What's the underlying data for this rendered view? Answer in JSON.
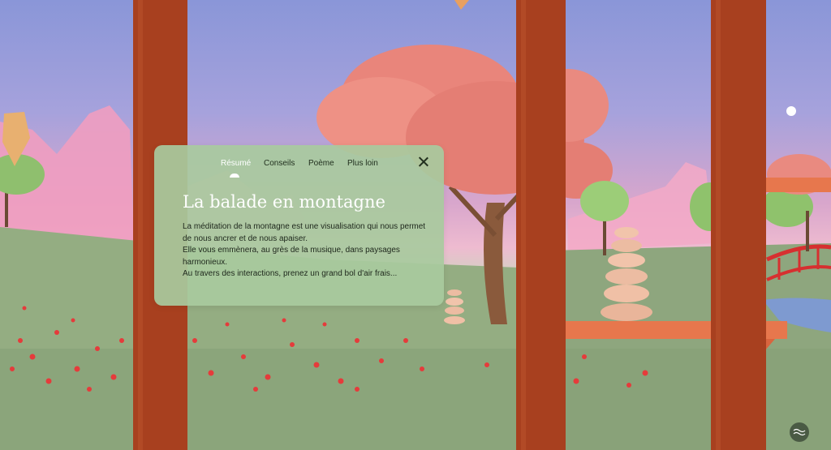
{
  "panel": {
    "tabs": [
      {
        "label": "Résumé",
        "active": true
      },
      {
        "label": "Conseils",
        "active": false
      },
      {
        "label": "Poème",
        "active": false
      },
      {
        "label": "Plus loin",
        "active": false
      }
    ],
    "title": "La balade en montagne",
    "description": [
      "La méditation de la montagne est une visualisation qui nous permet de nous ancrer et de nous apaiser.",
      "Elle vous emmènera, au grès de la musique, dans paysages harmonieux.",
      "Au travers des interactions, prenez un grand bol d'air frais..."
    ]
  },
  "icons": {
    "close": "close-icon",
    "audio": "sound-wave-icon"
  },
  "colors": {
    "panel_bg": "#a8ca9e",
    "pillar": "#a8401f",
    "tree_blossom": "#e98a80",
    "flowers": "#e53b3b"
  }
}
